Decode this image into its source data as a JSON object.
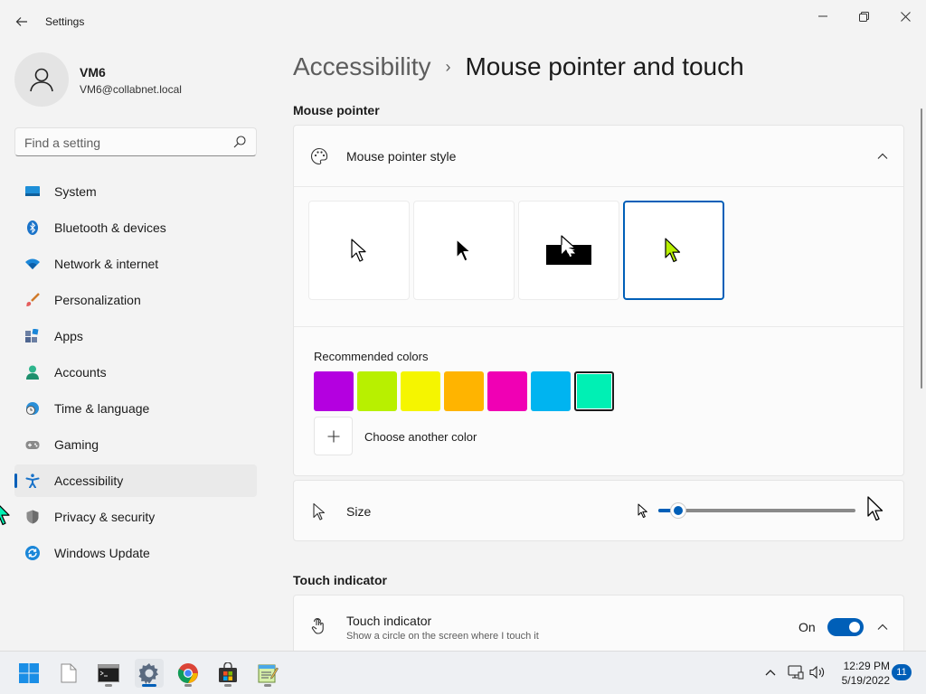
{
  "window": {
    "title": "Settings",
    "controls": {
      "minimize": "minimize",
      "maximize": "maximize",
      "close": "close"
    }
  },
  "user": {
    "name": "VM6",
    "email": "VM6@collabnet.local"
  },
  "search": {
    "placeholder": "Find a setting",
    "value": ""
  },
  "sidebar": {
    "items": [
      {
        "label": "System",
        "icon": "system-icon",
        "active": false
      },
      {
        "label": "Bluetooth & devices",
        "icon": "bluetooth-icon",
        "active": false
      },
      {
        "label": "Network & internet",
        "icon": "wifi-icon",
        "active": false
      },
      {
        "label": "Personalization",
        "icon": "brush-icon",
        "active": false
      },
      {
        "label": "Apps",
        "icon": "apps-icon",
        "active": false
      },
      {
        "label": "Accounts",
        "icon": "person-icon",
        "active": false
      },
      {
        "label": "Time & language",
        "icon": "clock-globe-icon",
        "active": false
      },
      {
        "label": "Gaming",
        "icon": "gamepad-icon",
        "active": false
      },
      {
        "label": "Accessibility",
        "icon": "accessibility-icon",
        "active": true
      },
      {
        "label": "Privacy & security",
        "icon": "shield-icon",
        "active": false
      },
      {
        "label": "Windows Update",
        "icon": "update-icon",
        "active": false
      }
    ]
  },
  "breadcrumb": {
    "parent": "Accessibility",
    "separator": "›",
    "current": "Mouse pointer and touch"
  },
  "mouse_pointer": {
    "section_title": "Mouse pointer",
    "style_row_label": "Mouse pointer style",
    "styles": [
      {
        "name": "white",
        "selected": false
      },
      {
        "name": "black",
        "selected": false
      },
      {
        "name": "inverted",
        "selected": false
      },
      {
        "name": "custom",
        "selected": true
      }
    ],
    "recommended_colors_label": "Recommended colors",
    "colors": [
      "#b400e0",
      "#b8f000",
      "#f5f500",
      "#ffb400",
      "#f000b4",
      "#00b4f0",
      "#00f0b4"
    ],
    "selected_color_index": 6,
    "choose_color_label": "Choose another color",
    "size_label": "Size",
    "size_value_fraction": 0.1
  },
  "touch": {
    "section_title": "Touch indicator",
    "row_title": "Touch indicator",
    "row_description": "Show a circle on the screen where I touch it",
    "toggle_state": "On"
  },
  "taskbar": {
    "apps": [
      {
        "name": "start",
        "active": false,
        "running": false
      },
      {
        "name": "file",
        "active": false,
        "running": false
      },
      {
        "name": "terminal",
        "active": false,
        "running": true
      },
      {
        "name": "settings",
        "active": true,
        "running": true
      },
      {
        "name": "chrome",
        "active": false,
        "running": true
      },
      {
        "name": "store",
        "active": false,
        "running": true
      },
      {
        "name": "notepad",
        "active": false,
        "running": true
      }
    ],
    "time": "12:29 PM",
    "date": "5/19/2022",
    "notification_count": "11"
  },
  "accent_color": "#005fb8"
}
